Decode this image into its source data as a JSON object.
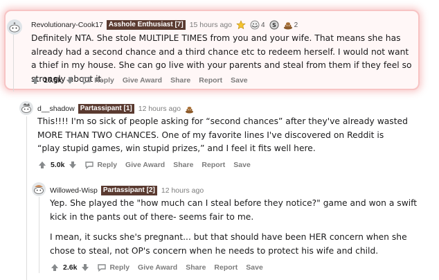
{
  "comments": [
    {
      "username": "Revolutionary-Cook17",
      "flair": "Asshole Enthusiast [7]",
      "time": "15 hours ago",
      "awards": [
        {
          "icon": "helpful-award-icon",
          "count": ""
        },
        {
          "icon": "wholesome-award-icon",
          "count": "4"
        },
        {
          "icon": "silver-award-icon",
          "count": ""
        },
        {
          "icon": "poop-award-icon",
          "count": "2"
        }
      ],
      "body": [
        "Definitely NTA. She stole MULTIPLE TIMES from you and your wife. That means she has already had a second chance and a third chance etc to redeem herself. I would not want a thief in my house. She can go live with your parents and steal from them if they feel so strongly about it."
      ],
      "votes": "16.5k",
      "actions": [
        "Reply",
        "Give Award",
        "Share",
        "Report",
        "Save"
      ]
    },
    {
      "username": "d__shadow",
      "flair": "Partassipant [1]",
      "time": "12 hours ago",
      "awards": [
        {
          "icon": "poop-award-icon",
          "count": ""
        }
      ],
      "body": [
        "This!!!! I'm so sick of people asking for “second chances” after they've already wasted MORE THAN TWO CHANCES. One of my favorite lines I've discovered on Reddit is “play stupid games, win stupid prizes,” and I feel it fits well here."
      ],
      "votes": "5.0k",
      "actions": [
        "Reply",
        "Give Award",
        "Share",
        "Report",
        "Save"
      ]
    },
    {
      "username": "Willowed-Wisp",
      "flair": "Partassipant [2]",
      "time": "12 hours ago",
      "awards": [],
      "body": [
        "Yep. She played the \"how much can I steal before they notice?\" game and won a swift kick in the pants out of there- seems fair to me.",
        "I mean, it sucks she's pregnant... but that should have been HER concern when she chose to steal, not OP's concern when he needs to protect his wife and child."
      ],
      "votes": "2.6k",
      "actions": [
        "Reply",
        "Give Award",
        "Share",
        "Report",
        "Save"
      ]
    }
  ],
  "colors": {
    "flair_bg": "#5a3a30",
    "highlight_glow": "#f08c8c",
    "meta_gray": "#7c7c7c"
  }
}
